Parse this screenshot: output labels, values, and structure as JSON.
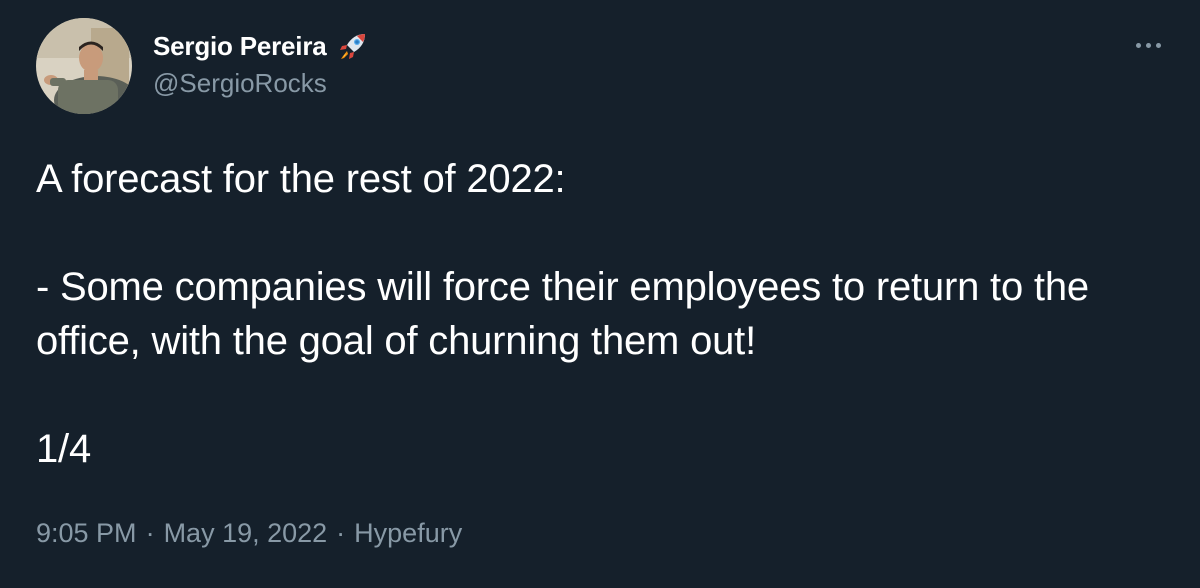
{
  "author": {
    "display_name": "Sergio Pereira",
    "handle": "@SergioRocks",
    "badge_emoji": "rocket-icon"
  },
  "tweet": {
    "lines": [
      "A forecast for the rest of 2022:",
      "- Some companies will force their employees to return to the office, with the goal of churning them out!",
      "1/4"
    ]
  },
  "meta": {
    "time": "9:05 PM",
    "separator": "·",
    "date": "May 19, 2022",
    "source": "Hypefury"
  },
  "colors": {
    "background": "#15202b",
    "primary_text": "#ffffff",
    "secondary_text": "#8899a6"
  },
  "icons": {
    "more": "more-options-icon",
    "avatar": "avatar"
  }
}
